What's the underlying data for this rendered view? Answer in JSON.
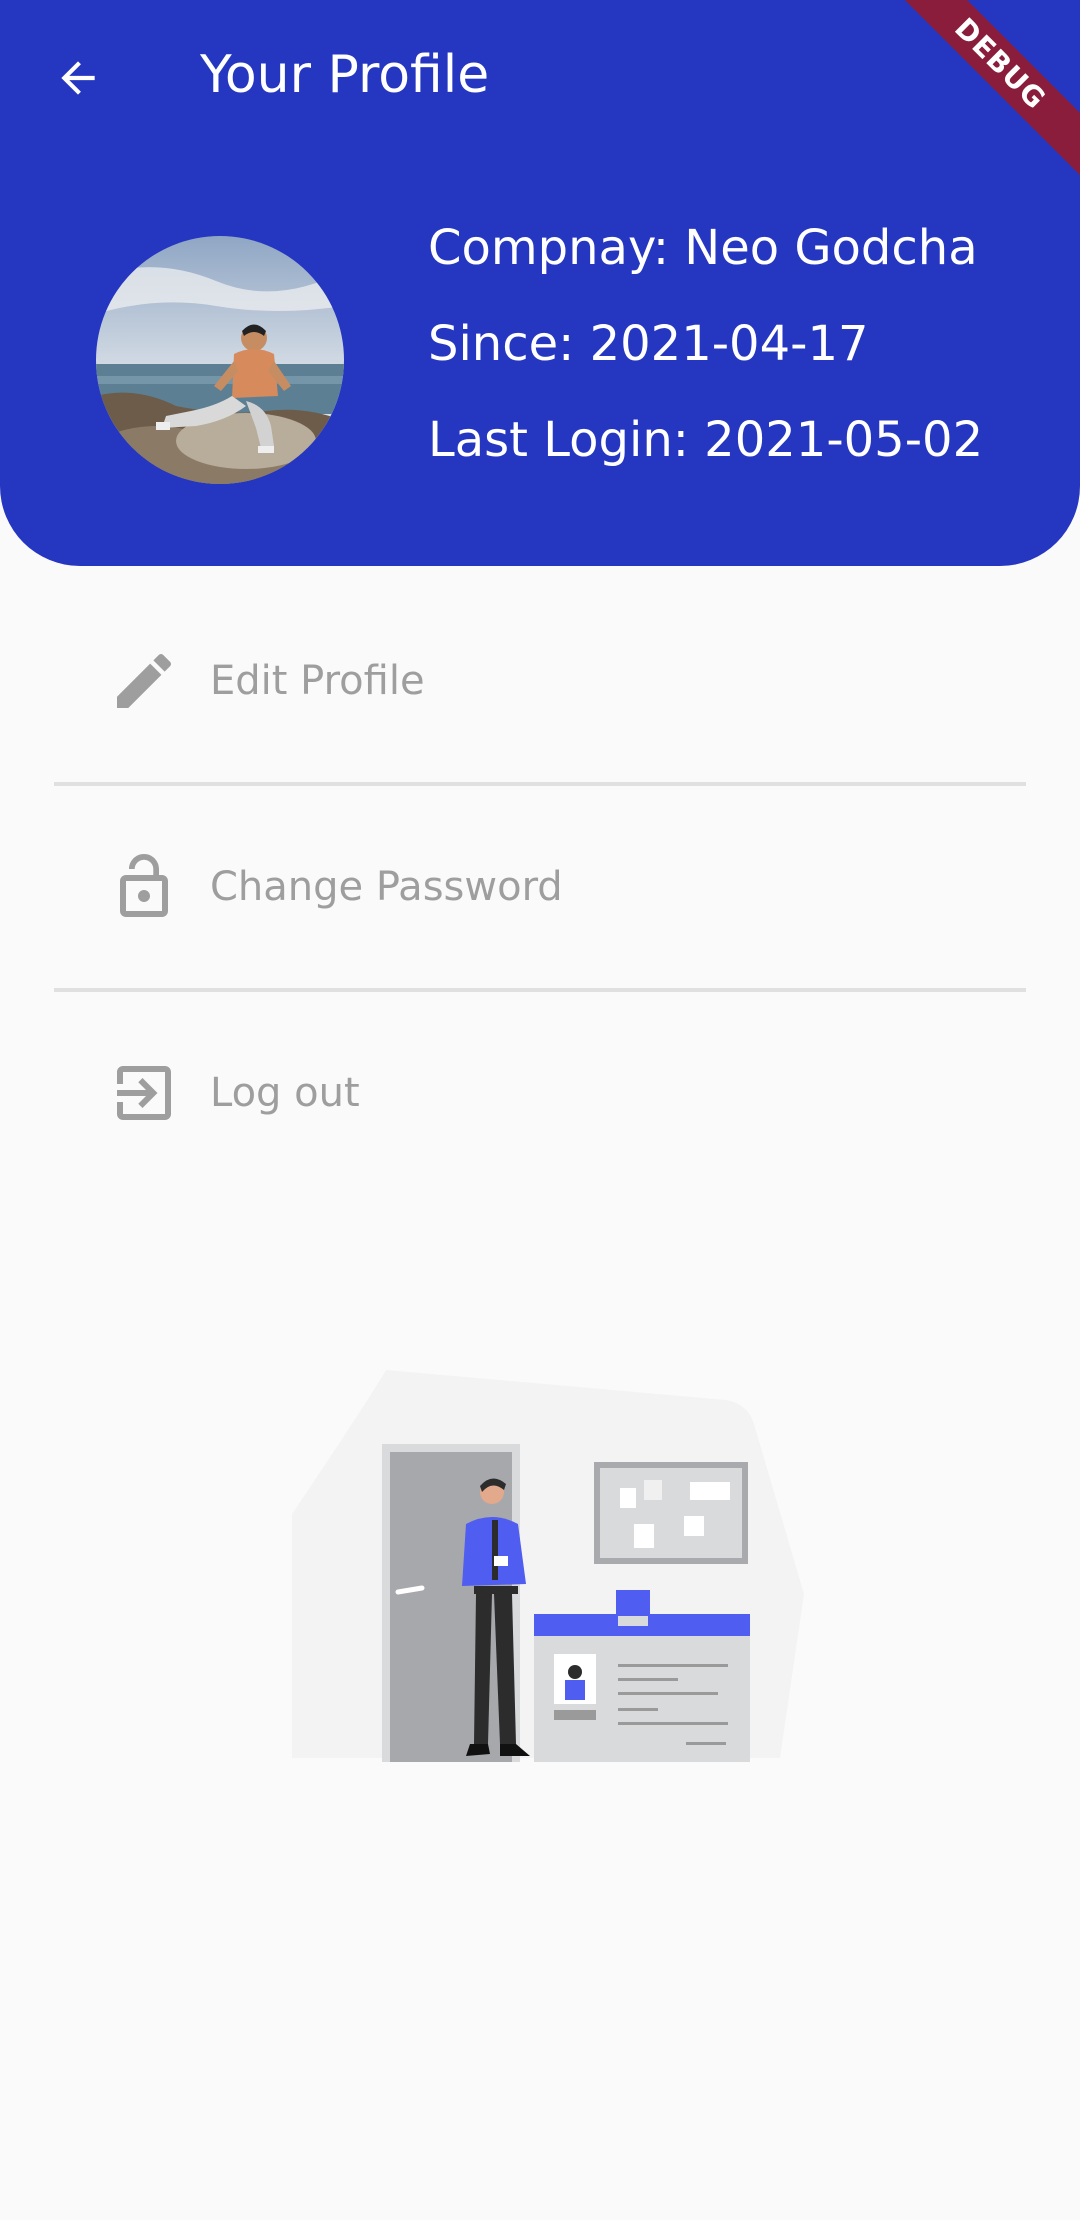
{
  "header": {
    "title": "Your Profile",
    "debug_label": "DEBUG",
    "background_color": "#2537c1"
  },
  "profile": {
    "company": "Compnay: Neo Godcha",
    "since": "Since: 2021-04-17",
    "last_login": "Last Login: 2021-05-02"
  },
  "menu": {
    "items": [
      {
        "label": "Edit Profile",
        "icon": "pencil-icon"
      },
      {
        "label": "Change Password",
        "icon": "lock-open-icon"
      },
      {
        "label": "Log out",
        "icon": "logout-icon"
      }
    ]
  },
  "illustration": {
    "accent_color": "#4f5ef0"
  }
}
